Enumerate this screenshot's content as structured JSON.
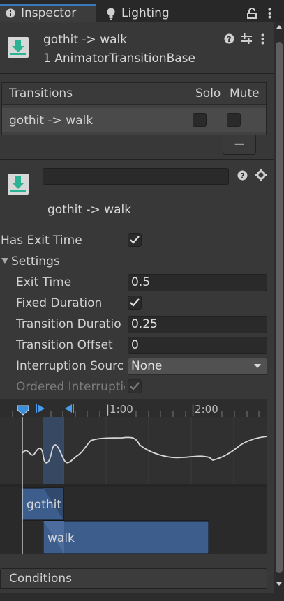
{
  "tabs": [
    {
      "label": "Inspector",
      "icon": "info-icon"
    },
    {
      "label": "Lighting",
      "icon": "lightbulb-icon"
    }
  ],
  "header": {
    "title": "gothit -> walk",
    "subtitle": "1 AnimatorTransitionBase"
  },
  "transitions": {
    "columns": [
      "Transitions",
      "Solo",
      "Mute"
    ],
    "rows": [
      {
        "name": "gothit -> walk",
        "solo": false,
        "mute": false
      }
    ],
    "remove_label": "−"
  },
  "transition": {
    "name_value": "",
    "title": "gothit -> walk"
  },
  "properties": {
    "has_exit_time_label": "Has Exit Time",
    "has_exit_time": true,
    "settings_label": "Settings",
    "exit_time_label": "Exit Time",
    "exit_time": "0.5",
    "fixed_duration_label": "Fixed Duration",
    "fixed_duration": true,
    "transition_duration_label": "Transition Duratio",
    "transition_duration": "0.25",
    "transition_offset_label": "Transition Offset",
    "transition_offset": "0",
    "interruption_source_label": "Interruption Sourc",
    "interruption_source": "None",
    "ordered_interruption_label": "Ordered Interruptic",
    "ordered_interruption": true
  },
  "timeline": {
    "ticks": [
      "|1:00",
      "|2:00"
    ],
    "source_clip": "gothit",
    "dest_clip": "walk"
  },
  "conditions": {
    "label": "Conditions"
  },
  "colors": {
    "accent": "#3a79bb",
    "clip": "#3d5d8c",
    "background": "#383838"
  }
}
